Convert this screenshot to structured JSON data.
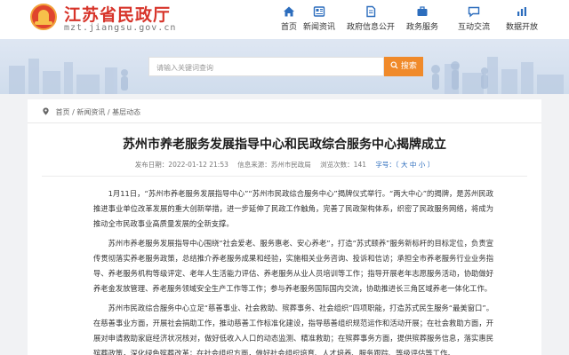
{
  "header": {
    "site_title": "江苏省民政厅",
    "site_domain": "mzt.jiangsu.gov.cn",
    "nav": [
      {
        "label": "首页",
        "icon": "home-icon"
      },
      {
        "label": "新闻资讯",
        "icon": "newspaper-icon"
      },
      {
        "label": "政府信息公开",
        "icon": "document-icon"
      },
      {
        "label": "政务服务",
        "icon": "briefcase-icon"
      },
      {
        "label": "互动交流",
        "icon": "chat-icon"
      },
      {
        "label": "数据开放",
        "icon": "bar-chart-icon"
      }
    ]
  },
  "search": {
    "placeholder": "请输入关键词查询",
    "button_label": "搜索"
  },
  "breadcrumb": {
    "home": "首页",
    "sep1": "/",
    "level1": "新闻资讯",
    "sep2": "/",
    "level2": "基层动态"
  },
  "article": {
    "title": "苏州市养老服务发展指导中心和民政综合服务中心揭牌成立",
    "published": "发布日期：2022-01-12 21:53",
    "source": "信息来源：苏州市民政局",
    "views": "浏览次数：141",
    "font_size": "字号：〔 大 中 小 〕",
    "paragraphs": [
      "1月11日，“苏州市养老服务发展指导中心”“苏州市民政综合服务中心”揭牌仪式举行。“两大中心”的揭牌，是苏州民政推进事业单位改革发展的重大创新举措，进一步延伸了民政工作触角，完善了民政架构体系，织密了民政服务网络，将成为推动全市民政事业高质量发展的全新支撑。",
      "苏州市养老服务发展指导中心围绕“社会爱老、服务惠老、安心养老”，打造“苏式颐养”服务新标杆的目标定位，负责宣传贯彻落实养老服务政策，总结推介养老服务成果和经验，实施相关业务咨询、投诉和信访；承担全市养老服务行业业务指导、养老服务机构等级评定、老年人生活能力评估、养老服务从业人员培训等工作；指导开展老年志愿服务活动，协助做好养老金发放管理、养老服务领域安全生产工作等工作；参与养老服务国际国内交流，协助推进长三角区域养老一体化工作。",
      "苏州市民政综合服务中心立足“慈善事业、社会救助、殡葬事务、社会组织”四项职能，打造苏式民生服务“最美窗口”。在慈善事业方面，开展社会捐助工作，推动慈善工作标准化建设，指导慈善组织规范运作和活动开展；在社会救助方面，开展对申请救助家庭经济状况核对，做好低收入人口的动态监测、精准救助；在殡葬事务方面，提供殡葬服务信息，落实惠民殡葬政策，深化绿色殡葬改革；在社会组织方面，做好社会组织培育、人才培养、服务跟踪、等级评估等工作。"
    ]
  },
  "colors": {
    "brand_red": "#d7342a",
    "nav_blue": "#2c6dbd",
    "search_orange": "#f08a2a"
  }
}
